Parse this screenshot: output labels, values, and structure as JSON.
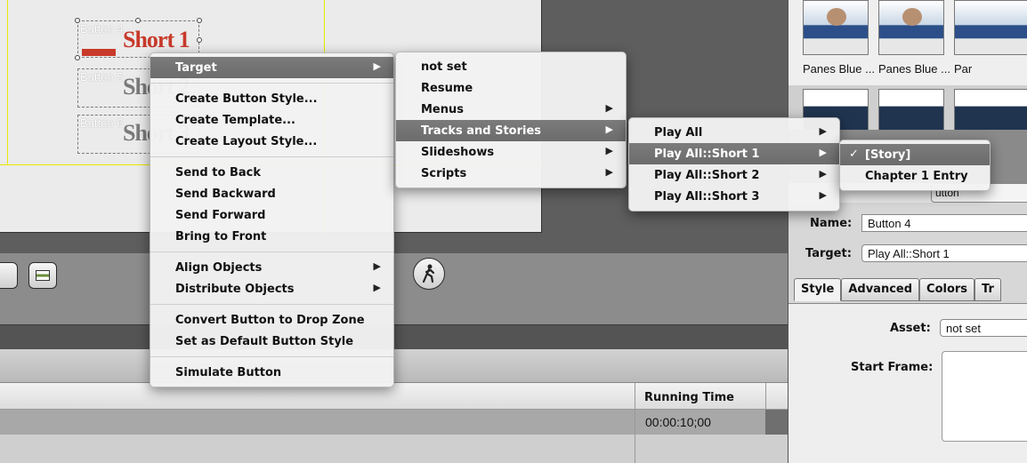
{
  "canvas": {
    "buttons": [
      {
        "name": "Button 4",
        "text": "Short 1"
      },
      {
        "name": "Button 5",
        "text": "Short 2"
      },
      {
        "name": "Button 6",
        "text": "Short 3"
      }
    ]
  },
  "timeline": {
    "running_time_header": "Running Time",
    "running_time_value": "00:00:10;00"
  },
  "templates": {
    "labels": [
      "Panes Blue ...",
      "Panes Blue ...",
      "Par"
    ]
  },
  "inspector": {
    "tab_stub": "utton",
    "name_label": "Name:",
    "name_value": "Button 4",
    "target_label": "Target:",
    "target_value": "Play All::Short 1",
    "tabs": [
      "Style",
      "Advanced",
      "Colors",
      "Tr"
    ],
    "asset_label": "Asset:",
    "asset_value": "not set",
    "start_frame_label": "Start Frame:"
  },
  "context_menu": {
    "groups": [
      [
        "Target"
      ],
      [
        "Create Button Style...",
        "Create Template...",
        "Create Layout Style..."
      ],
      [
        "Send to Back",
        "Send Backward",
        "Send Forward",
        "Bring to Front"
      ],
      [
        "Align Objects",
        "Distribute Objects"
      ],
      [
        "Convert Button to Drop Zone",
        "Set as Default Button Style"
      ],
      [
        "Simulate Button"
      ]
    ]
  },
  "target_menu": {
    "items": [
      "not set",
      "Resume",
      "Menus",
      "Tracks and Stories",
      "Slideshows",
      "Scripts"
    ]
  },
  "tracks_menu": {
    "items": [
      "Play All",
      "Play All::Short 1",
      "Play All::Short 2",
      "Play All::Short 3"
    ]
  },
  "short1_menu": {
    "items": [
      "[Story]",
      "Chapter 1 Entry"
    ]
  },
  "colors": {
    "highlight": "#707070",
    "button_text_red": "#c83a2a",
    "guide_yellow": "#e8e800"
  }
}
